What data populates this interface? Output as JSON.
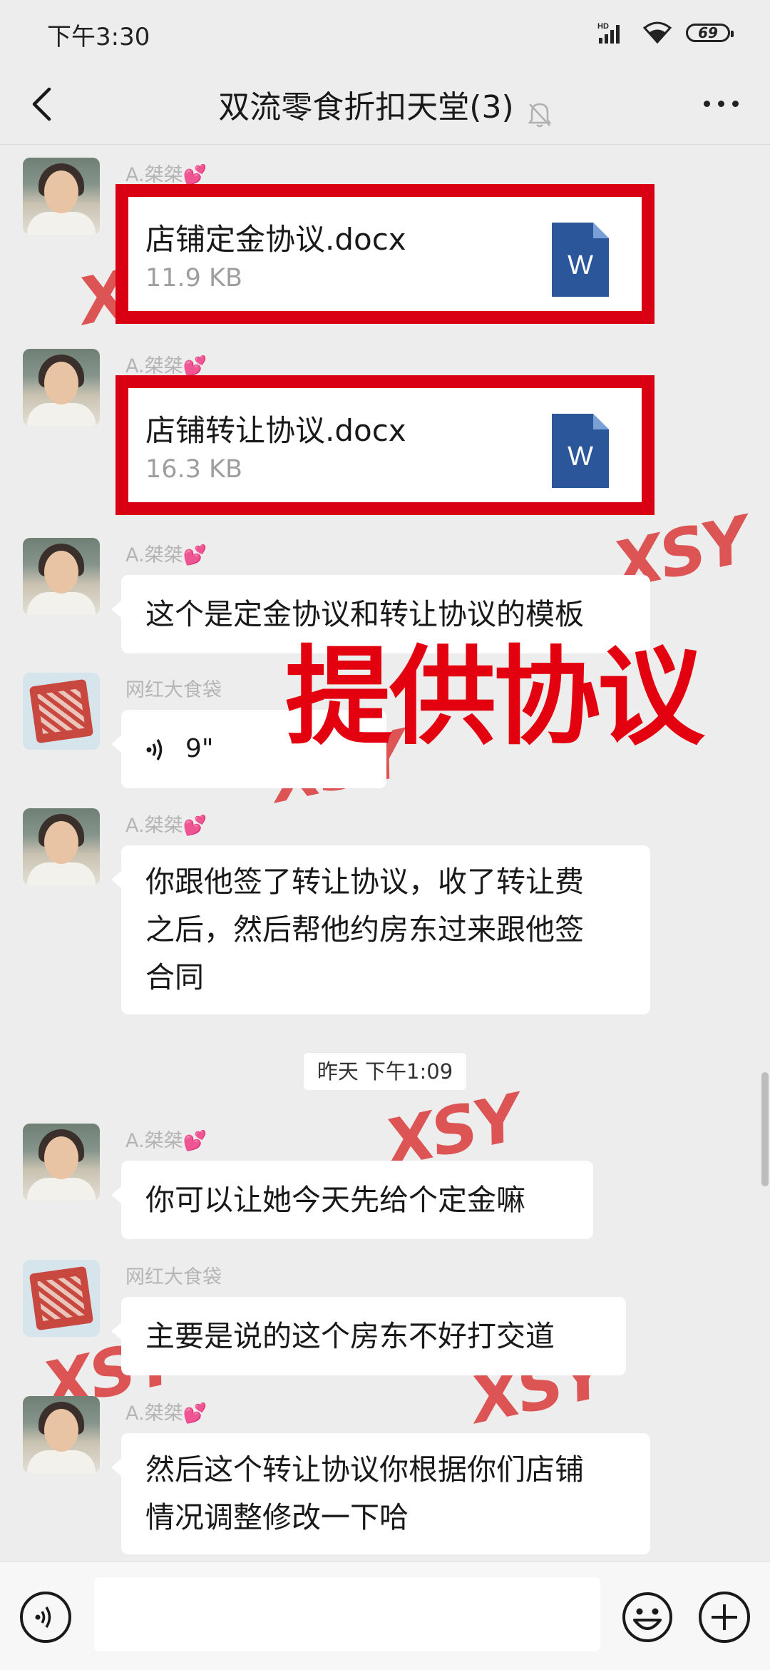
{
  "status_bar": {
    "time": "下午3:30",
    "battery": "69",
    "network": "HD"
  },
  "header": {
    "title": "双流零食折扣天堂(3)"
  },
  "watermarks": [
    "XSY",
    "XSY",
    "XSY",
    "XSY",
    "XSY",
    "XSY"
  ],
  "overlay_text": "提供协议",
  "messages": [
    {
      "sender": "A.桀桀💕",
      "file_name": "店铺定金协议.docx",
      "file_size": "11.9 KB",
      "file_icon": "W"
    },
    {
      "sender": "A.桀桀💕",
      "file_name": "店铺转让协议.docx",
      "file_size": "16.3 KB",
      "file_icon": "W"
    },
    {
      "sender": "A.桀桀💕",
      "text": "这个是定金协议和转让协议的模板"
    },
    {
      "sender": "网红大食袋",
      "voice_duration": "9\""
    },
    {
      "sender": "A.桀桀💕",
      "text_lines": [
        "你跟他签了转让协议，收了转让费",
        "之后，然后帮他约房东过来跟他签",
        "合同"
      ]
    },
    {
      "sender": "A.桀桀💕",
      "text": "你可以让她今天先给个定金嘛"
    },
    {
      "sender": "网红大食袋",
      "text": "主要是说的这个房东不好打交道"
    },
    {
      "sender": "A.桀桀💕",
      "text_lines": [
        "然后这个转让协议你根据你们店铺",
        "情况调整修改一下哈"
      ]
    }
  ],
  "timestamp": "昨天 下午1:09",
  "icons": {
    "back": "chevron-left-icon",
    "mute": "bell-off-icon",
    "more": "more-dots-icon",
    "voice_input": "voice-icon",
    "emoji": "emoji-icon",
    "plus": "plus-icon",
    "file": "word-doc-icon"
  }
}
